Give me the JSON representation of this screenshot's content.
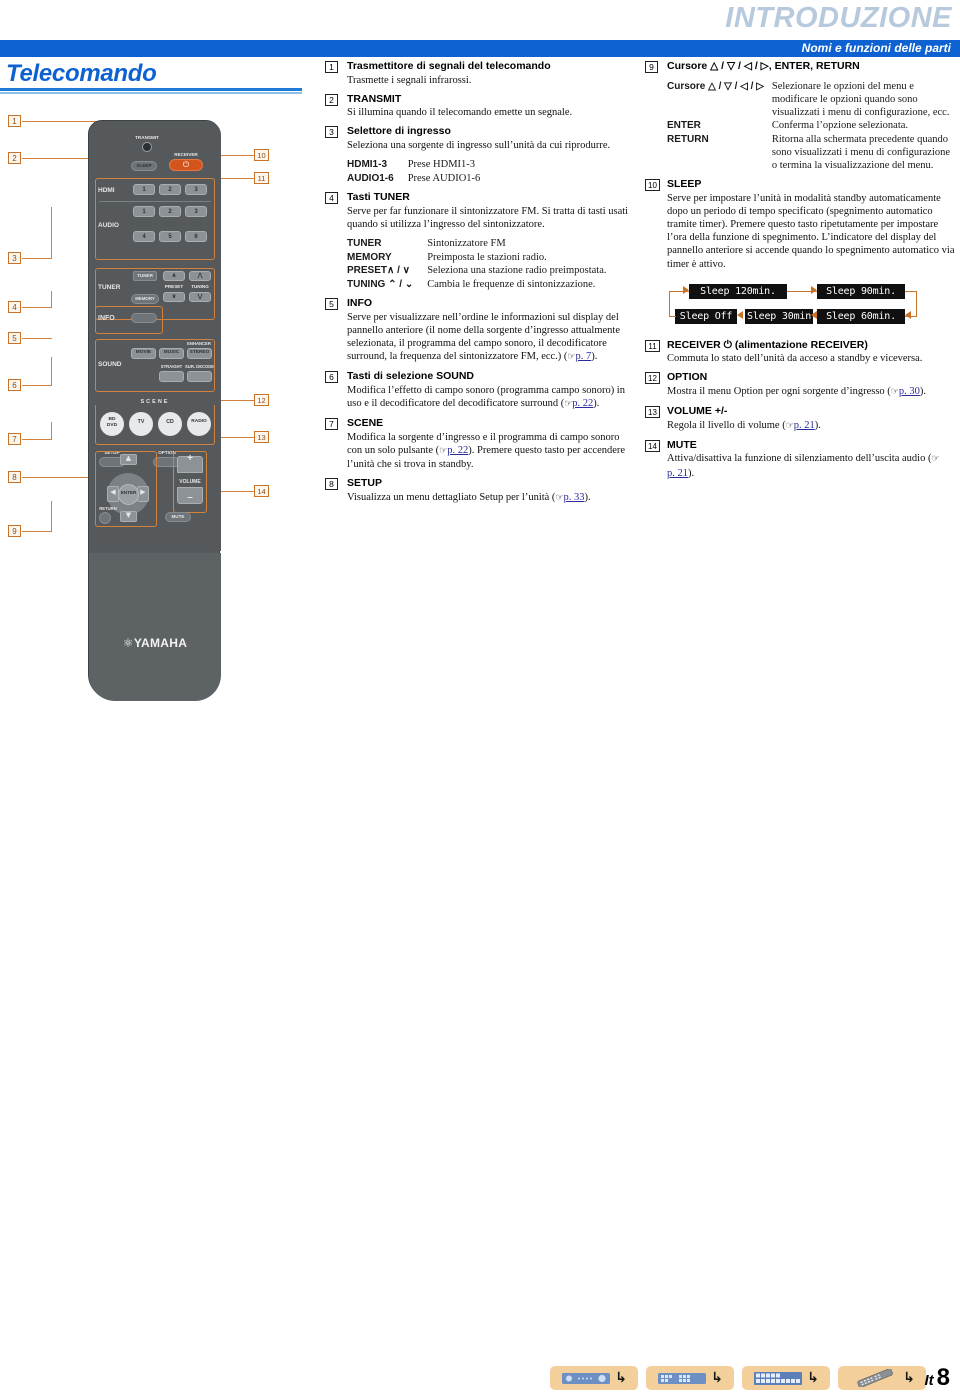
{
  "header": {
    "chapter": "INTRODUZIONE",
    "subtitle": "Nomi e funzioni delle parti",
    "page_title": "Telecomando"
  },
  "middle_column": [
    {
      "num": "1",
      "heading": "Trasmettitore di segnali del telecomando",
      "body": "Trasmette i segnali infrarossi."
    },
    {
      "num": "2",
      "heading": "TRANSMIT",
      "body": "Si illumina quando il telecomando emette un segnale."
    },
    {
      "num": "3",
      "heading": "Selettore di ingresso",
      "body": "Seleziona una sorgente di ingresso sull’unità da cui riprodurre.",
      "table": [
        {
          "key": "HDMI1-3",
          "value": "Prese HDMI1-3"
        },
        {
          "key": "AUDIO1-6",
          "value": "Prese AUDIO1-6"
        }
      ]
    },
    {
      "num": "4",
      "heading": "Tasti TUNER",
      "body": "Serve per far funzionare il sintonizzatore FM. Si tratta di tasti usati quando si utilizza l’ingresso del sintonizzatore.",
      "table": [
        {
          "key": "TUNER",
          "value": "Sintonizzatore FM"
        },
        {
          "key": "MEMORY",
          "value": "Preimposta le stazioni radio."
        },
        {
          "key": "PRESET∧ / ∨",
          "value": "Seleziona una stazione radio preimpostata."
        },
        {
          "key": "TUNING ⌃ / ⌄",
          "value": "Cambia le frequenze di sintonizzazione."
        }
      ]
    },
    {
      "num": "5",
      "heading": "INFO",
      "body": "Serve per visualizzare nell’ordine le informazioni sul display del pannello anteriore (il nome della sorgente d’ingresso attualmente selezionata, il programma del campo sonoro, il decodificatore surround, la frequenza del sintonizzatore FM, ecc.) (",
      "ref": "p. 7",
      "body_tail": ")."
    },
    {
      "num": "6",
      "heading": "Tasti di selezione SOUND",
      "body": "Modifica l’effetto di campo sonoro (programma campo sonoro) in uso e il decodificatore del decodificatore surround (",
      "ref": "p. 22",
      "body_tail": ")."
    },
    {
      "num": "7",
      "heading": "SCENE",
      "body": "Modifica la sorgente d’ingresso e il programma di campo sonoro con un solo pulsante (",
      "ref": "p. 22",
      "body_tail": "). Premere questo tasto per accendere l’unità che si trova in standby."
    },
    {
      "num": "8",
      "heading": "SETUP",
      "body": "Visualizza un menu dettagliato Setup per l’unità (",
      "ref": "p. 33",
      "body_tail": ")."
    }
  ],
  "right_column": [
    {
      "num": "9",
      "heading": "Cursore △ / ▽ / ◁ / ▷, ENTER, RETURN",
      "table": [
        {
          "key": "Cursore △ / ▽ / ◁ / ▷",
          "value": "Selezionare le opzioni del menu e modificare le opzioni quando sono visualizzati i menu di configurazione, ecc."
        },
        {
          "key": "ENTER",
          "value": "Conferma l’opzione selezionata."
        },
        {
          "key": "RETURN",
          "value": "Ritorna alla schermata precedente quando sono visualizzati i menu di configurazione o termina la visualizzazione del menu."
        }
      ]
    },
    {
      "num": "10",
      "heading": "SLEEP",
      "body": "Serve per impostare l’unità in modalità standby automaticamente dopo un periodo di tempo specificato (spegnimento automatico tramite timer). Premere questo tasto ripetutamente per impostare l’ora della funzione di spegnimento. L’indicatore del display del pannello anteriore si accende quando lo spegnimento automatico via timer è attivo."
    },
    {
      "num": "11",
      "heading": "RECEIVER ⏻ (alimentazione RECEIVER)",
      "body": "Commuta lo stato dell’unità da acceso a standby e viceversa."
    },
    {
      "num": "12",
      "heading": "OPTION",
      "body": "Mostra il menu Option per ogni sorgente d’ingresso (",
      "ref": "p. 30",
      "body_tail": ")."
    },
    {
      "num": "13",
      "heading": "VOLUME +/-",
      "body": "Regola il livello di volume (",
      "ref": "p. 21",
      "body_tail": ")."
    },
    {
      "num": "14",
      "heading": "MUTE",
      "body": "Attiva/disattiva la funzione di silenziamento dell’uscita audio (",
      "ref": "p. 21",
      "body_tail": ")."
    }
  ],
  "sleep_diagram": {
    "states": [
      "Sleep 120min.",
      "Sleep 90min.",
      "Sleep 60min.",
      "Sleep 30min.",
      "Sleep Off"
    ]
  },
  "remote": {
    "brand": "YAMAHA",
    "transmit_label": "TRANSMIT",
    "sleep_label": "SLEEP",
    "receiver_label": "RECEIVER",
    "receiver_power_glyph": "⏻",
    "hdmi_label": "HDMI",
    "audio_label": "AUDIO",
    "hdmi_buttons": [
      "1",
      "2",
      "3"
    ],
    "audio_row1": [
      "1",
      "2",
      "3"
    ],
    "audio_row2": [
      "4",
      "5",
      "6"
    ],
    "tuner_section_label": "TUNER",
    "tuner_button": "TUNER",
    "memory_button": "MEMORY",
    "preset_label": "PRESET",
    "tuning_label": "TUNING",
    "info_label": "INFO",
    "sound_label": "SOUND",
    "sound_buttons": [
      "MOVIE",
      "MUSIC",
      "STEREO"
    ],
    "enhancer_label": "ENHANCER",
    "straight_label": "STRAIGHT",
    "sur_decode_label": "SUR. DECODE",
    "scene_label": "SCENE",
    "scene_buttons": [
      "BD\nDVD",
      "TV",
      "CD",
      "RADIO"
    ],
    "setup_label": "SETUP",
    "option_label": "OPTION",
    "enter_label": "ENTER",
    "return_label": "RETURN",
    "volume_label": "VOLUME",
    "volume_plus": "+",
    "volume_minus": "–",
    "mute_label": "MUTE",
    "callouts_left": [
      "1",
      "2",
      "3",
      "4",
      "5",
      "6",
      "7",
      "8",
      "9"
    ],
    "callouts_right": [
      "10",
      "11",
      "12",
      "13",
      "14"
    ]
  },
  "footer": {
    "nav_items": [
      {
        "name": "receiver-front-panel",
        "arrow": "↳"
      },
      {
        "name": "receiver-rear-panel",
        "arrow": "↳"
      },
      {
        "name": "front-display",
        "arrow": "↳"
      },
      {
        "name": "remote-control",
        "arrow": "↳"
      }
    ],
    "locale": "It",
    "page_number": "8"
  },
  "colors": {
    "brand_blue": "#0d61d0",
    "chapter_tint": "#b7c9dd",
    "callout_orange": "#c8732a",
    "footer_tan": "#f3cf9c",
    "remote_body": "#55595c",
    "lcd_bg": "#101010"
  }
}
